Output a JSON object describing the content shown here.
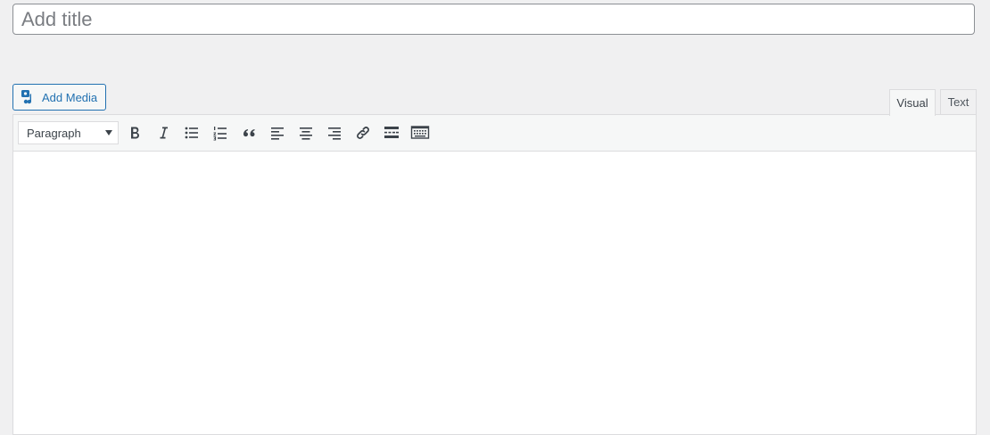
{
  "title_field": {
    "placeholder": "Add title",
    "value": ""
  },
  "media": {
    "add_media_label": "Add Media",
    "icon": "add-media-icon"
  },
  "tabs": [
    {
      "label": "Visual",
      "active": true
    },
    {
      "label": "Text",
      "active": false
    }
  ],
  "toolbar": {
    "format_select": {
      "selected": "Paragraph"
    },
    "buttons": [
      {
        "name": "bold",
        "icon": "bold-icon"
      },
      {
        "name": "italic",
        "icon": "italic-icon"
      },
      {
        "name": "bulleted-list",
        "icon": "bullet-list-icon"
      },
      {
        "name": "numbered-list",
        "icon": "numbered-list-icon"
      },
      {
        "name": "blockquote",
        "icon": "blockquote-icon"
      },
      {
        "name": "align-left",
        "icon": "align-left-icon"
      },
      {
        "name": "align-center",
        "icon": "align-center-icon"
      },
      {
        "name": "align-right",
        "icon": "align-right-icon"
      },
      {
        "name": "insert-link",
        "icon": "link-icon"
      },
      {
        "name": "read-more",
        "icon": "read-more-icon"
      },
      {
        "name": "toolbar-toggle",
        "icon": "keyboard-icon"
      }
    ]
  },
  "colors": {
    "page_bg": "#f0f0f1",
    "accent": "#2271b1",
    "icon": "#3c434a",
    "border": "#dcdcde"
  }
}
